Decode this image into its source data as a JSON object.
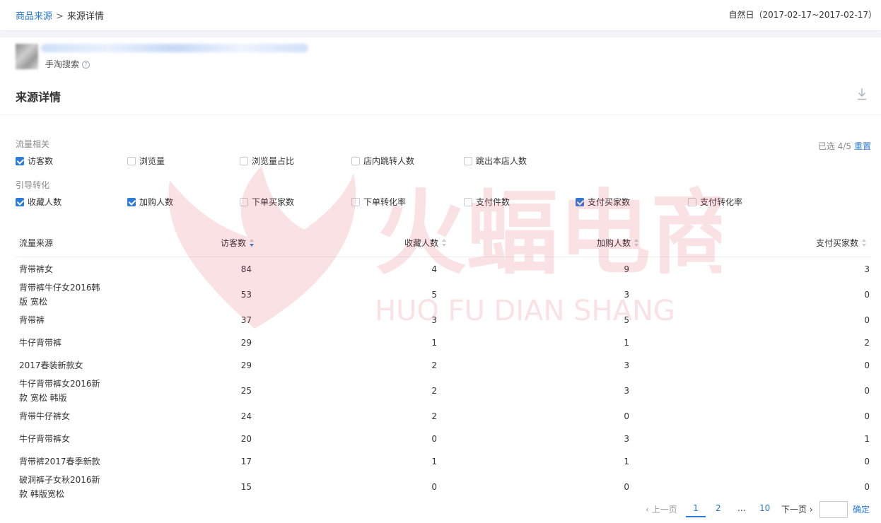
{
  "breadcrumb": {
    "parent": "商品来源",
    "separator": ">",
    "current": "来源详情"
  },
  "date_range": "自然日（2017-02-17~2017-02-17）",
  "source": {
    "name": "手淘搜索"
  },
  "section_title": "来源详情",
  "filters": {
    "group1_label": "流量相关",
    "group1": [
      {
        "label": "访客数",
        "checked": true
      },
      {
        "label": "浏览量",
        "checked": false
      },
      {
        "label": "浏览量占比",
        "checked": false
      },
      {
        "label": "店内跳转人数",
        "checked": false
      },
      {
        "label": "跳出本店人数",
        "checked": false
      }
    ],
    "group2_label": "引导转化",
    "group2": [
      {
        "label": "收藏人数",
        "checked": true
      },
      {
        "label": "加购人数",
        "checked": true
      },
      {
        "label": "下单买家数",
        "checked": false
      },
      {
        "label": "下单转化率",
        "checked": false
      },
      {
        "label": "支付件数",
        "checked": false
      },
      {
        "label": "支付买家数",
        "checked": true
      },
      {
        "label": "支付转化率",
        "checked": false
      }
    ],
    "selected_text": "已选 4/5",
    "reset_label": "重置"
  },
  "table": {
    "headers": [
      "流量来源",
      "访客数",
      "收藏人数",
      "加购人数",
      "支付买家数"
    ],
    "rows": [
      {
        "name": "背带裤女",
        "visitors": "84",
        "favorites": "4",
        "cart": "9",
        "buyers": "3"
      },
      {
        "name": "背带裤牛仔女2016韩版 宽松",
        "visitors": "53",
        "favorites": "5",
        "cart": "3",
        "buyers": "0"
      },
      {
        "name": "背带裤",
        "visitors": "37",
        "favorites": "3",
        "cart": "5",
        "buyers": "0"
      },
      {
        "name": "牛仔背带裤",
        "visitors": "29",
        "favorites": "1",
        "cart": "1",
        "buyers": "2"
      },
      {
        "name": "2017春装新款女",
        "visitors": "29",
        "favorites": "2",
        "cart": "3",
        "buyers": "0"
      },
      {
        "name": "牛仔背带裤女2016新款 宽松 韩版",
        "visitors": "25",
        "favorites": "2",
        "cart": "3",
        "buyers": "0"
      },
      {
        "name": "背带牛仔裤女",
        "visitors": "24",
        "favorites": "2",
        "cart": "0",
        "buyers": "0"
      },
      {
        "name": "牛仔背带裤女",
        "visitors": "20",
        "favorites": "0",
        "cart": "3",
        "buyers": "1"
      },
      {
        "name": "背带裤2017春季新款",
        "visitors": "17",
        "favorites": "1",
        "cart": "1",
        "buyers": "0"
      },
      {
        "name": "破洞裤子女秋2016新款 韩版宽松",
        "visitors": "15",
        "favorites": "0",
        "cart": "0",
        "buyers": "0"
      }
    ]
  },
  "pagination": {
    "prev_label": "上一页",
    "pages": [
      "1",
      "2",
      "...",
      "10"
    ],
    "current": "1",
    "next_label": "下一页",
    "confirm_label": "确定"
  },
  "watermark": {
    "cn": "火蝠电商",
    "en": "HUO FU DIAN SHANG"
  },
  "colors": {
    "accent": "#2b7bd8",
    "watermark": "#e0314a"
  }
}
